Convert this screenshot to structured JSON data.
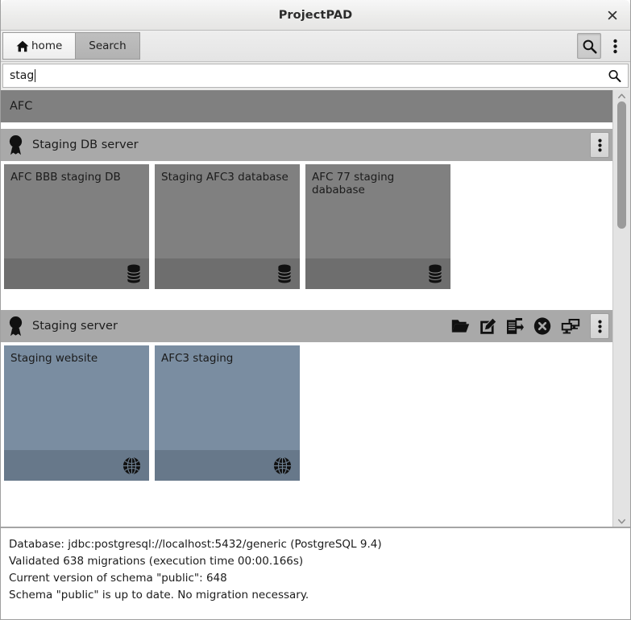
{
  "window": {
    "title": "ProjectPAD",
    "close_label": "✕"
  },
  "toolbar": {
    "tabs": [
      {
        "label": "home",
        "icon": "home-icon",
        "active": true
      },
      {
        "label": "Search",
        "icon": "",
        "active": false
      }
    ],
    "search_toggle_icon": "search-icon",
    "overflow_menu_icon": "kebab-menu-icon"
  },
  "search": {
    "value": "stag",
    "placeholder": "",
    "icon": "search-icon"
  },
  "results": {
    "project_banner": "AFC",
    "groups": [
      {
        "icon": "award-ribbon-icon",
        "title": "Staging DB server",
        "actions": [],
        "menu_icon": "kebab-menu-icon",
        "card_type": "db",
        "card_icon": "database-icon",
        "cards": [
          {
            "title": "AFC BBB staging DB"
          },
          {
            "title": "Staging AFC3 database"
          },
          {
            "title": "AFC 77 staging dababase"
          }
        ]
      },
      {
        "icon": "award-ribbon-icon",
        "title": "Staging server",
        "actions": [
          {
            "icon": "open-folder-icon",
            "name": "open-folder-action"
          },
          {
            "icon": "edit-pencil-icon",
            "name": "edit-action"
          },
          {
            "icon": "copy-clipboard-icon",
            "name": "copy-action"
          },
          {
            "icon": "close-circle-icon",
            "name": "close-action"
          },
          {
            "icon": "remote-desktop-icon",
            "name": "remote-desktop-action"
          }
        ],
        "menu_icon": "kebab-menu-icon",
        "card_type": "web",
        "card_icon": "globe-icon",
        "cards": [
          {
            "title": "Staging website"
          },
          {
            "title": "AFC3 staging"
          }
        ]
      }
    ]
  },
  "scrollbar": {
    "up_arrow": "chevron-up-icon",
    "down_arrow": "chevron-down-icon"
  },
  "log": {
    "lines": [
      "Database: jdbc:postgresql://localhost:5432/generic (PostgreSQL 9.4)",
      "Validated 638 migrations (execution time 00:00.166s)",
      "Current version of schema \"public\": 648",
      "Schema \"public\" is up to date. No migration necessary."
    ]
  },
  "colors": {
    "db_card": "#808080",
    "db_card_footer": "#6e6e6e",
    "web_card": "#7a8da1",
    "web_card_footer": "#67788a",
    "group_header": "#a9a9a9",
    "project_banner": "#808080"
  }
}
